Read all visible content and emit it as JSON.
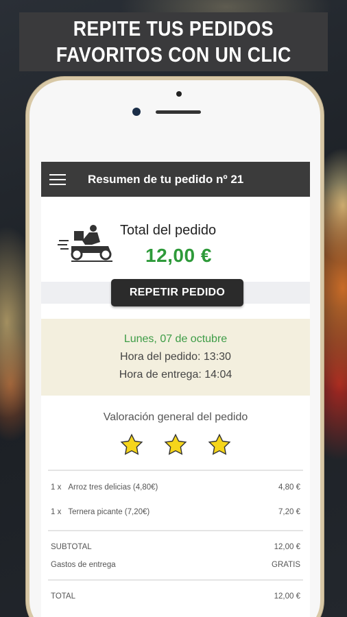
{
  "headline": {
    "line1": "REPITE TUS PEDIDOS",
    "line2": "FAVORITOS CON UN CLIC"
  },
  "app": {
    "title": "Resumen de tu pedido nº 21",
    "menu_icon": "hamburger-menu-icon"
  },
  "order": {
    "total_label": "Total del pedido",
    "total_value": "12,00 €",
    "repeat_label": "REPETIR PEDIDO",
    "date": "Lunes, 07 de octubre",
    "order_time": "Hora del pedido: 13:30",
    "delivery_time": "Hora de entrega: 14:04",
    "rating_label": "Valoración general del pedido",
    "stars": 3
  },
  "items": [
    {
      "qty": "1 x",
      "name": "Arroz tres delicias (4,80€)",
      "price": "4,80 €"
    },
    {
      "qty": "1 x",
      "name": "Ternera picante (7,20€)",
      "price": "7,20 €"
    }
  ],
  "totals": {
    "subtotal_label": "SUBTOTAL",
    "subtotal_value": "12,00 €",
    "delivery_label": "Gastos de entrega",
    "delivery_value": "GRATIS",
    "total_label": "TOTAL",
    "total_value": "12,00 €"
  },
  "colors": {
    "accent_green": "#2e9a3a",
    "star_yellow": "#f5d51b",
    "appbar": "#3b3b3b"
  }
}
